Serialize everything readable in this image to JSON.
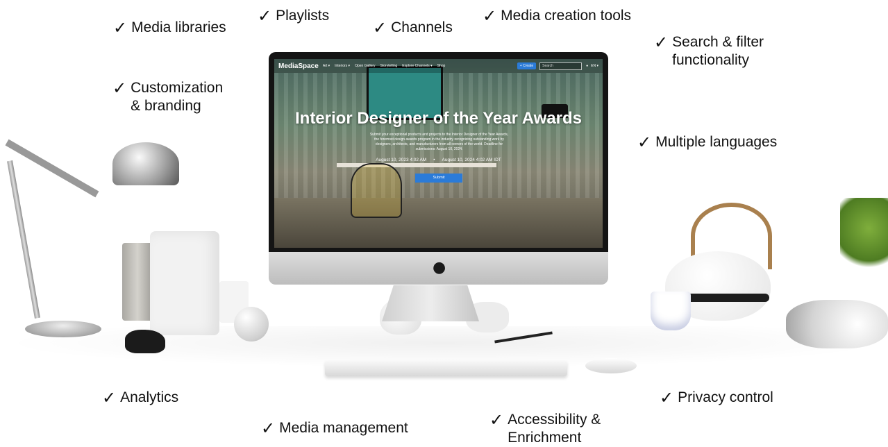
{
  "features": [
    {
      "id": "media-libraries",
      "label": "Media libraries"
    },
    {
      "id": "playlists",
      "label": "Playlists"
    },
    {
      "id": "channels",
      "label": "Channels"
    },
    {
      "id": "media-creation-tools",
      "label": "Media creation tools"
    },
    {
      "id": "search-filter",
      "label": "Search & filter\nfunctionality"
    },
    {
      "id": "customization",
      "label": "Customization\n& branding"
    },
    {
      "id": "multiple-languages",
      "label": "Multiple languages"
    },
    {
      "id": "analytics",
      "label": "Analytics"
    },
    {
      "id": "privacy-control",
      "label": "Privacy control"
    },
    {
      "id": "media-management",
      "label": "Media management"
    },
    {
      "id": "accessibility",
      "label": "Accessibility &\nEnrichment"
    }
  ],
  "check_glyph": "✓",
  "screen": {
    "logo": "MediaSpace",
    "nav": [
      "Art ▾",
      "Interiors ▾",
      "Open Gallery",
      "Storytelling",
      "Explore Channels ▾",
      "Shop"
    ],
    "create_label": "+ Create",
    "search_placeholder": "Search",
    "user_icon": "user-icon",
    "lang": "EN ▾",
    "hero_title": "Interior Designer of the Year Awards",
    "hero_desc": "Submit your exceptional products and projects to the Interior Designer of the Year Awards, the foremost design awards program in the industry recognizing outstanding work by designers, architects, and manufacturers from all corners of the world. Deadline for submissions: August 10, 2024.",
    "date_start": "August 10, 2023 4:02 AM",
    "date_sep": "•",
    "date_end": "August 10, 2024 4:02 AM IDT",
    "submit_label": "Submit"
  },
  "colors": {
    "accent": "#2b7bd8",
    "text": "#111111"
  }
}
